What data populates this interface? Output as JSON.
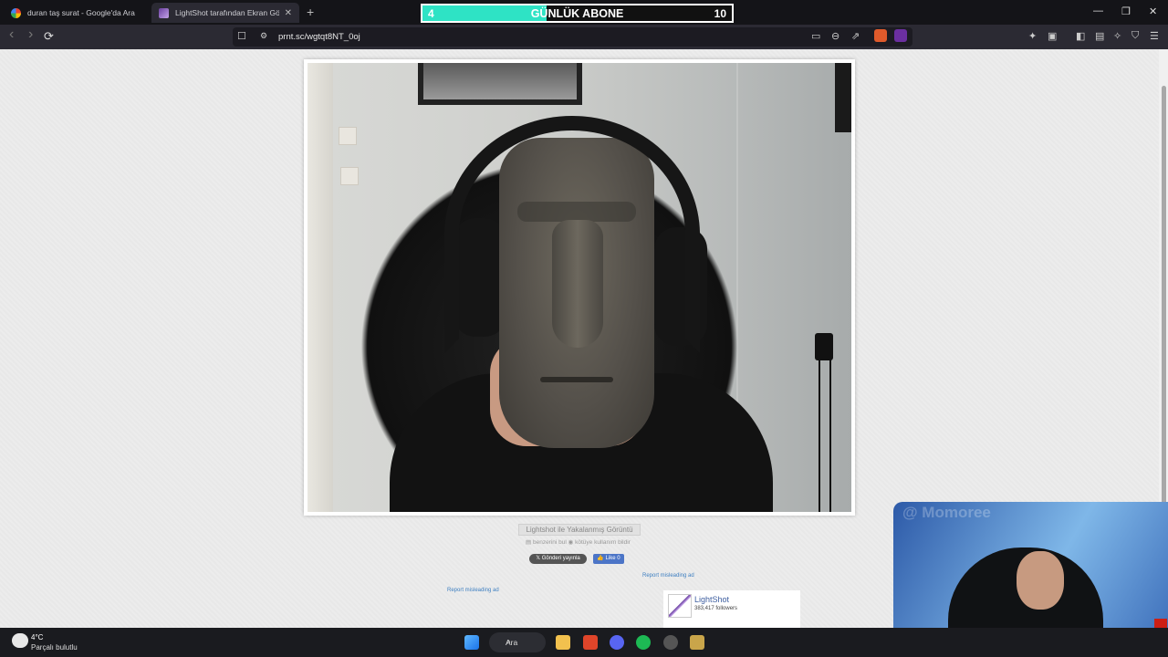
{
  "tabs": [
    {
      "title": "duran taş surat - Google'da Ara",
      "close": ""
    },
    {
      "title": "LightShot tarafından Ekran Görü",
      "close": "✕"
    }
  ],
  "new_tab": "+",
  "subscriber_goal": {
    "current": "4",
    "label": "GÜNLÜK ABONE",
    "target": "10",
    "progress": 0.4,
    "color": "#2ee3c5"
  },
  "window_controls": {
    "minimize": "—",
    "maximize": "❐",
    "close": "✕"
  },
  "nav": {
    "back": "‹",
    "forward": "›",
    "reload": "⟳"
  },
  "address_bar": {
    "url": "prnt.sc/wgtqt8NT_0oj"
  },
  "page": {
    "caption": "Lightshot ile Yakalanmış Görüntü",
    "find_similar": "benzerini bul",
    "report_abuse": "kötüye kullanım bildir",
    "tweet_label": "Gönderi yayınla",
    "like_label": "Like 0",
    "report_ad_left": "Report misleading ad",
    "report_ad_right": "Report misleading ad",
    "widget": {
      "name": "LightShot",
      "followers": "383,417 followers"
    }
  },
  "webcam": {
    "watermark": "@ Momoree"
  },
  "taskbar": {
    "weather_temp": "4°C",
    "weather_desc": "Parçalı bulutlu",
    "search_label": "Ara"
  }
}
